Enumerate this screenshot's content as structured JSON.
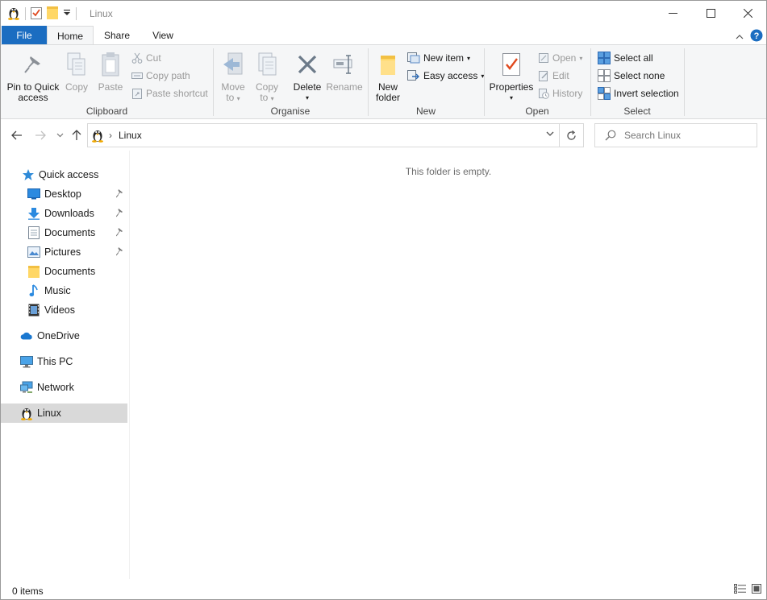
{
  "window": {
    "title": "Linux"
  },
  "qat": {
    "icons": [
      "linux-penguin-icon",
      "properties-check-icon",
      "folder-icon",
      "customize-dropdown-icon"
    ]
  },
  "tabs": [
    {
      "label": "File"
    },
    {
      "label": "Home"
    },
    {
      "label": "Share"
    },
    {
      "label": "View"
    }
  ],
  "ribbon": {
    "clipboard": {
      "label": "Clipboard",
      "pin": "Pin to Quick",
      "pin2": "access",
      "copy": "Copy",
      "paste": "Paste",
      "cut": "Cut",
      "copy_path": "Copy path",
      "paste_shortcut": "Paste shortcut"
    },
    "organise": {
      "label": "Organise",
      "move": "Move",
      "move2": "to",
      "copy": "Copy",
      "copy2": "to",
      "delete": "Delete",
      "rename": "Rename"
    },
    "new": {
      "label": "New",
      "new_folder": "New",
      "new_folder2": "folder",
      "new_item": "New item",
      "easy_access": "Easy access"
    },
    "open": {
      "label": "Open",
      "properties": "Properties",
      "open": "Open",
      "edit": "Edit",
      "history": "History"
    },
    "select": {
      "label": "Select",
      "select_all": "Select all",
      "select_none": "Select none",
      "invert": "Invert selection"
    }
  },
  "address": {
    "path": "Linux",
    "search_placeholder": "Search Linux"
  },
  "nav": {
    "quick_access": "Quick access",
    "items": [
      {
        "label": "Desktop",
        "pinned": true
      },
      {
        "label": "Downloads",
        "pinned": true
      },
      {
        "label": "Documents",
        "pinned": true
      },
      {
        "label": "Pictures",
        "pinned": true
      },
      {
        "label": "Documents",
        "pinned": false
      },
      {
        "label": "Music",
        "pinned": false
      },
      {
        "label": "Videos",
        "pinned": false
      }
    ],
    "onedrive": "OneDrive",
    "this_pc": "This PC",
    "network": "Network",
    "linux": "Linux"
  },
  "content": {
    "empty_message": "This folder is empty."
  },
  "status": {
    "count": "0 items"
  },
  "colors": {
    "accent": "#1b6dc1",
    "selection": "#d9d9d9",
    "ribbon_bg": "#f5f6f7"
  }
}
